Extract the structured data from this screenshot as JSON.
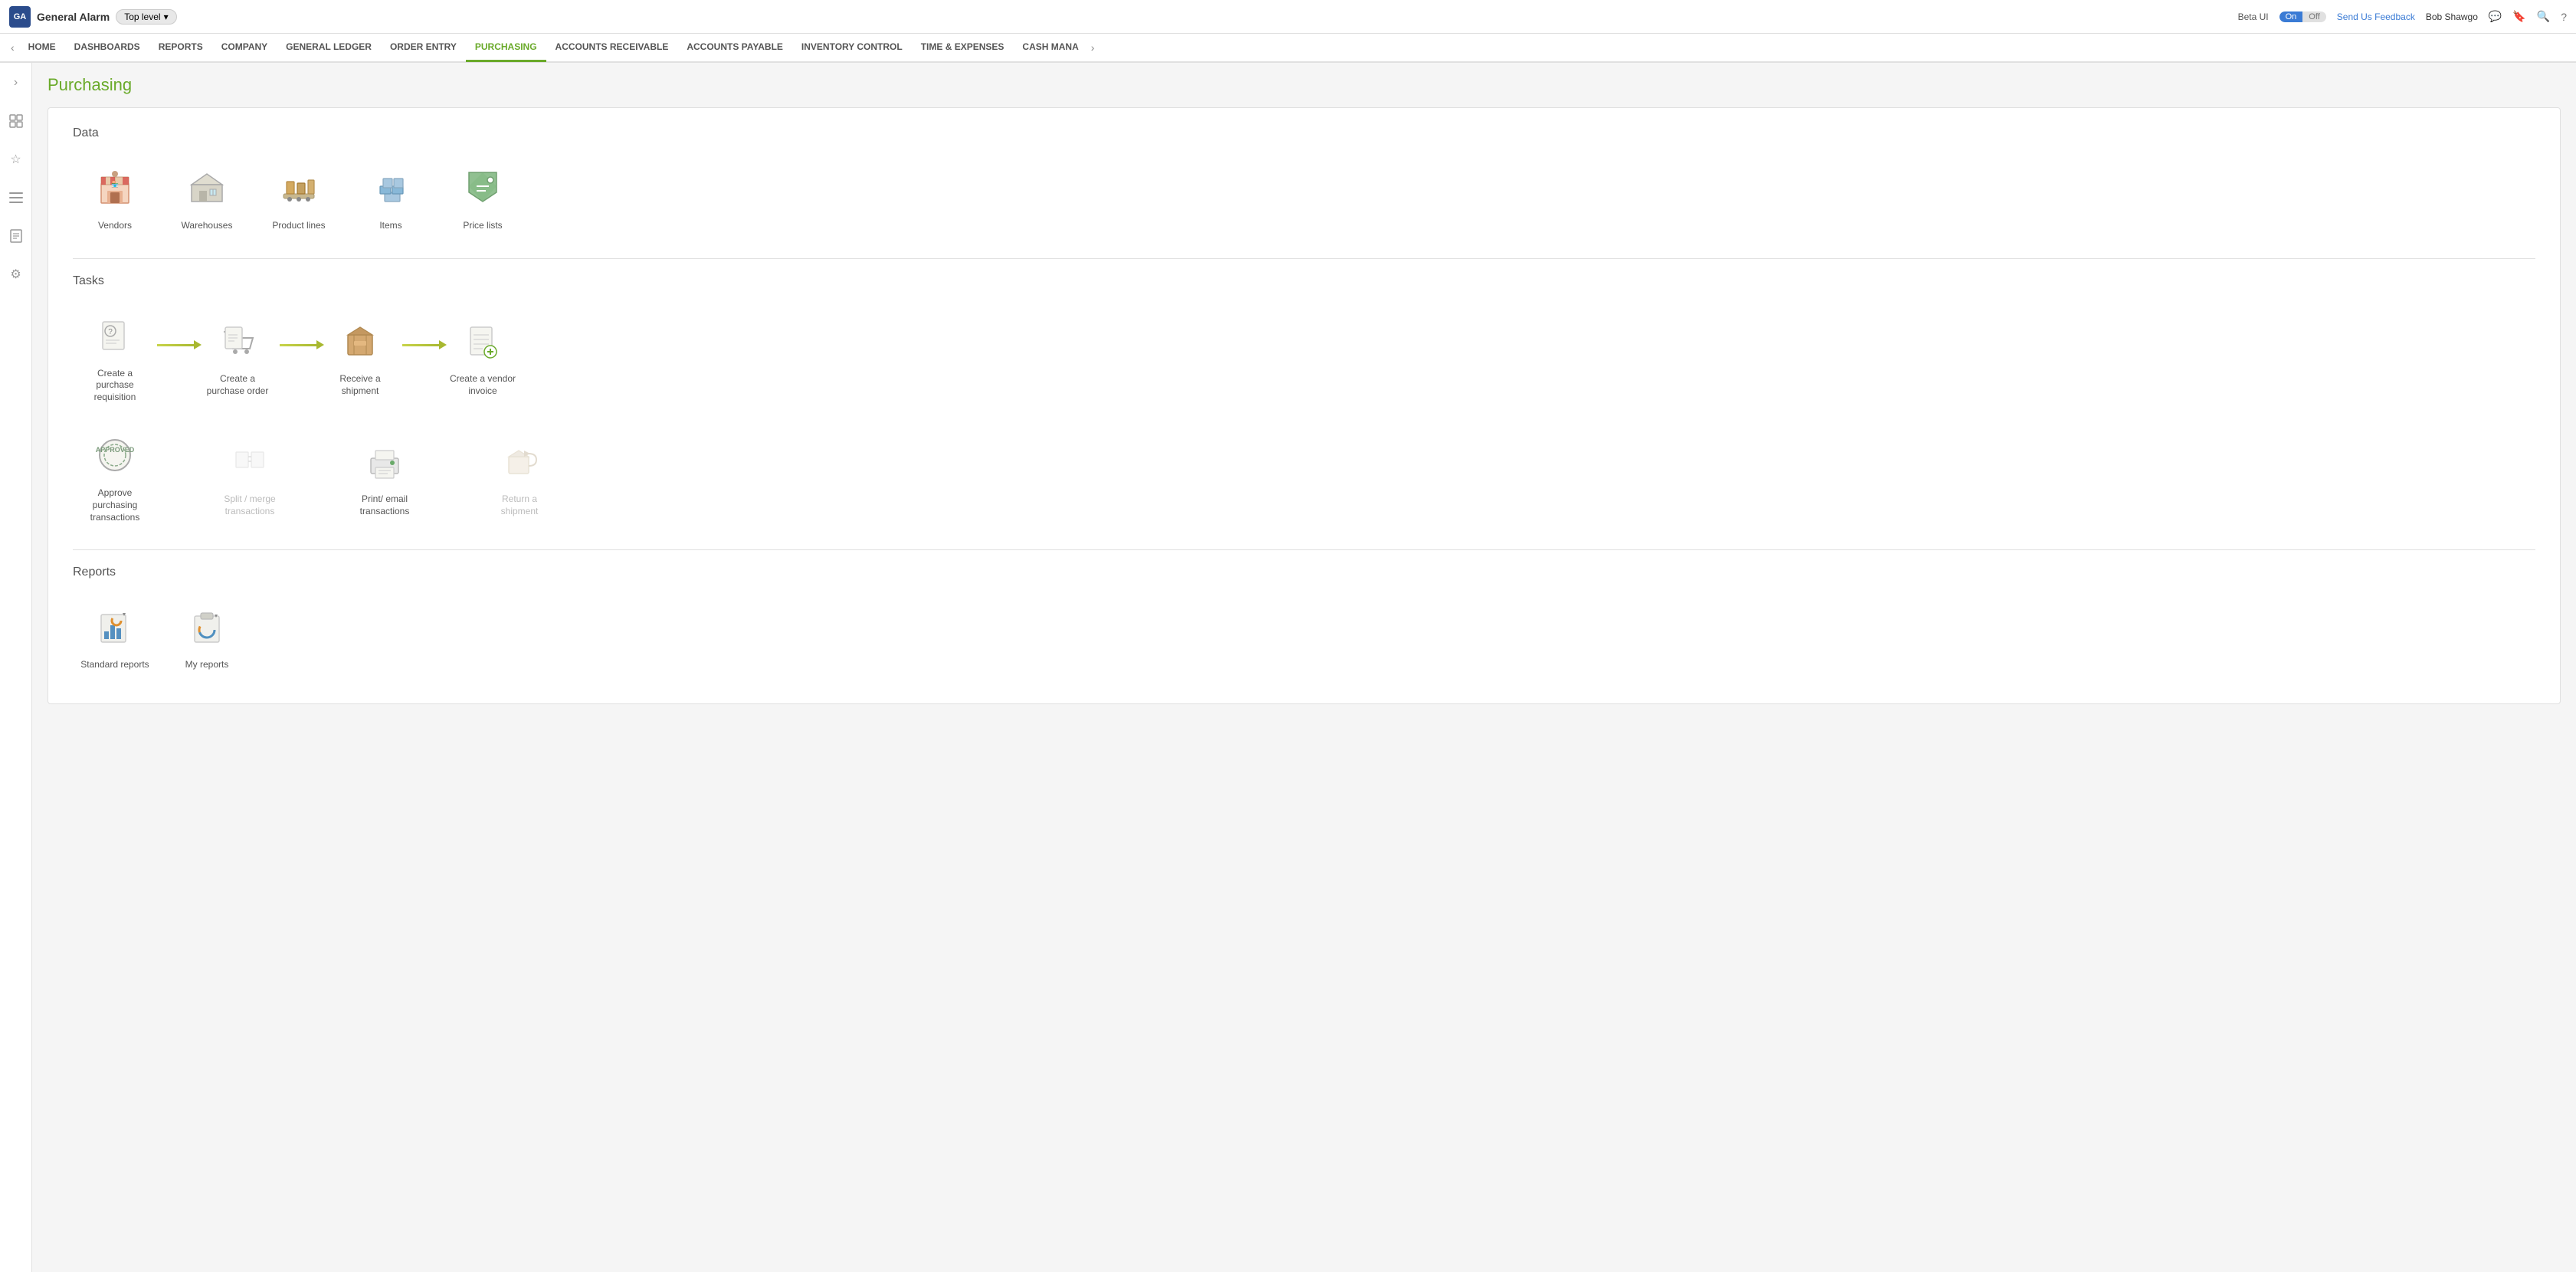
{
  "app": {
    "logo_text": "GA",
    "name": "General Alarm",
    "top_level": "Top level",
    "beta_ui_label": "Beta UI",
    "toggle_on": "On",
    "toggle_off": "Off",
    "feedback_link": "Send Us Feedback",
    "user_name": "Bob Shawgo"
  },
  "nav": {
    "back_arrow": "‹",
    "more_arrow": "›",
    "items": [
      {
        "label": "HOME",
        "active": false
      },
      {
        "label": "DASHBOARDS",
        "active": false
      },
      {
        "label": "REPORTS",
        "active": false
      },
      {
        "label": "COMPANY",
        "active": false
      },
      {
        "label": "GENERAL LEDGER",
        "active": false
      },
      {
        "label": "ORDER ENTRY",
        "active": false
      },
      {
        "label": "PURCHASING",
        "active": true
      },
      {
        "label": "ACCOUNTS RECEIVABLE",
        "active": false
      },
      {
        "label": "ACCOUNTS PAYABLE",
        "active": false
      },
      {
        "label": "INVENTORY CONTROL",
        "active": false
      },
      {
        "label": "TIME & EXPENSES",
        "active": false
      },
      {
        "label": "CASH MANA",
        "active": false
      }
    ]
  },
  "sidebar": {
    "icons": [
      {
        "name": "expand-icon",
        "symbol": "›"
      },
      {
        "name": "grid-icon",
        "symbol": "⊞"
      },
      {
        "name": "star-icon",
        "symbol": "☆"
      },
      {
        "name": "list-icon",
        "symbol": "☰"
      },
      {
        "name": "doc-icon",
        "symbol": "📄"
      },
      {
        "name": "settings-icon",
        "symbol": "⚙"
      }
    ]
  },
  "page": {
    "title": "Purchasing"
  },
  "data_section": {
    "title": "Data",
    "items": [
      {
        "label": "Vendors",
        "name": "vendors-icon",
        "disabled": false
      },
      {
        "label": "Warehouses",
        "name": "warehouses-icon",
        "disabled": false
      },
      {
        "label": "Product lines",
        "name": "product-lines-icon",
        "disabled": false
      },
      {
        "label": "Items",
        "name": "items-icon",
        "disabled": false
      },
      {
        "label": "Price lists",
        "name": "price-lists-icon",
        "disabled": false
      }
    ]
  },
  "tasks_section": {
    "title": "Tasks",
    "row1": [
      {
        "label": "Create a purchase requisition",
        "name": "create-purchase-req-icon",
        "disabled": false
      },
      {
        "label": "Create a purchase order",
        "name": "create-purchase-order-icon",
        "disabled": false
      },
      {
        "label": "Receive a shipment",
        "name": "receive-shipment-icon",
        "disabled": false
      },
      {
        "label": "Create a vendor invoice",
        "name": "create-vendor-invoice-icon",
        "disabled": false
      }
    ],
    "row2": [
      {
        "label": "Approve purchasing transactions",
        "name": "approve-purchasing-icon",
        "disabled": false
      },
      {
        "label": "Split / merge transactions",
        "name": "split-merge-icon",
        "disabled": true
      },
      {
        "label": "Print/ email transactions",
        "name": "print-email-icon",
        "disabled": false
      },
      {
        "label": "Return a shipment",
        "name": "return-shipment-icon",
        "disabled": true
      }
    ]
  },
  "reports_section": {
    "title": "Reports",
    "items": [
      {
        "label": "Standard reports",
        "name": "standard-reports-icon",
        "disabled": false
      },
      {
        "label": "My reports",
        "name": "my-reports-icon",
        "disabled": false
      }
    ]
  }
}
